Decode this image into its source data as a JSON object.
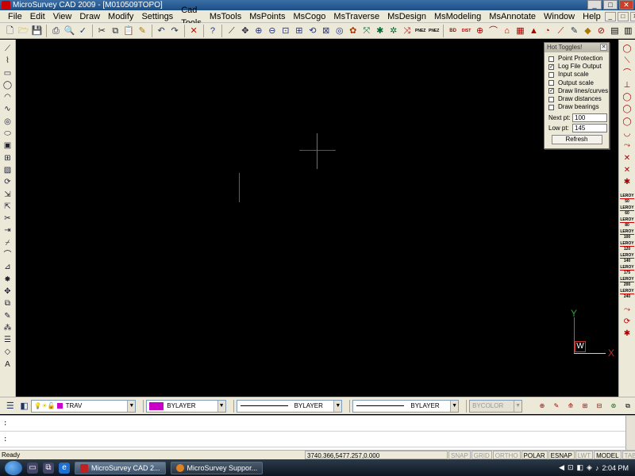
{
  "window": {
    "title": "MicroSurvey CAD 2009 - [M010509TOPO]",
    "buttons": [
      "_",
      "□",
      "✕"
    ]
  },
  "menubar": {
    "items": [
      "File",
      "Edit",
      "View",
      "Draw",
      "Modify",
      "Settings",
      "Cad Tools",
      "MsTools",
      "MsPoints",
      "MsCogo",
      "MsTraverse",
      "MsDesign",
      "MsModeling",
      "MsAnnotate",
      "Window",
      "Help"
    ],
    "mdi_buttons": [
      "_",
      "□",
      "✕"
    ]
  },
  "toolbar_top": {
    "icons": [
      "new-icon",
      "open-icon",
      "save-icon",
      "print-icon",
      "print-preview-icon",
      "spell-icon",
      "cut-icon",
      "copy-icon",
      "paste-icon",
      "match-properties-icon",
      "undo-icon",
      "redo-icon",
      "cancel-icon",
      "help-icon",
      "pan-line-icon",
      "zoom-realtime-icon",
      "zoom-in-icon",
      "zoom-out-icon",
      "zoom-window-icon",
      "zoom-extents-icon",
      "zoom-previous-icon",
      "zoom-all-icon",
      "zoom-pick-icon",
      "tools-1-icon",
      "tools-2-icon",
      "tools-3-icon",
      "tools-4-icon",
      "tools-5-icon",
      "pnez1-icon",
      "pnez2-icon",
      "bd-icon",
      "dist-icon",
      "tools-6-icon",
      "tools-7-icon",
      "tools-8-icon",
      "tools-9-icon",
      "tools-10-icon",
      "tools-11-icon",
      "tools-12-icon",
      "tools-13-icon",
      "tools-14-icon",
      "tools-15-icon",
      "tools-16-icon",
      "tools-17-icon"
    ],
    "text_buttons": {
      "pnez1": "PNEZ",
      "pnez2": "PNEZ",
      "bd": "BD",
      "dist": "DIST"
    }
  },
  "toolbar_left": {
    "icons": [
      "line-icon",
      "polyline-icon",
      "rectangle-icon",
      "circle-icon",
      "arc-icon",
      "spline-icon",
      "donut-icon",
      "ellipse-icon",
      "block-icon",
      "insert-icon",
      "hatch-icon",
      "rotate-icon",
      "stretch-icon",
      "scale-icon",
      "trim-icon",
      "extend-icon",
      "break-icon",
      "fillet-icon",
      "chamfer-icon",
      "explode-icon",
      "move-icon",
      "copy-obj-icon",
      "erase-icon",
      "array-icon",
      "properties-icon",
      "layer-icon",
      "text-icon"
    ]
  },
  "toolbar_right": {
    "icons": [
      "circle-r-icon",
      "line-r-icon",
      "arc-r-icon",
      "perpendicular-icon",
      "circle-r2-icon",
      "circle-r3-icon",
      "circle-r4-icon",
      "arc-r2-icon",
      "arrow-r-icon",
      "cross-r-icon",
      "cross-r2-icon",
      "cross-r3-icon"
    ],
    "leroy_labels": [
      "50",
      "60",
      "80",
      "100",
      "120",
      "140",
      "175",
      "200",
      "240"
    ],
    "leroy_word": "LEROY",
    "bottom_icons": [
      "edit-r-icon",
      "rotate-r-icon",
      "cross-r4-icon"
    ]
  },
  "hot_toggles": {
    "title": "Hot Toggles!",
    "close": "✕",
    "options": [
      {
        "label": "Point Protection",
        "checked": false
      },
      {
        "label": "Log File Output",
        "checked": true
      },
      {
        "label": "Input scale",
        "checked": false
      },
      {
        "label": "Output scale",
        "checked": false
      },
      {
        "label": "Draw lines/curves",
        "checked": true
      },
      {
        "label": "Draw distances",
        "checked": false
      },
      {
        "label": "Draw bearings",
        "checked": false
      }
    ],
    "next_pt_label": "Next pt:",
    "next_pt_value": "100",
    "low_pt_label": "Low pt:",
    "low_pt_value": "145",
    "refresh_label": "Refresh"
  },
  "ucs": {
    "y": "Y",
    "x": "X",
    "w": "W"
  },
  "props_bar": {
    "layer": "TRAV",
    "color": "BYLAYER",
    "color_hex": "#c800c8",
    "linetype": "BYLAYER",
    "lineweight": "BYLAYER",
    "plotstyle": "BYCOLOR"
  },
  "command": {
    "line1": ":",
    "line2": ":"
  },
  "status": {
    "ready": "Ready",
    "coords": "3740.366,5477.257,0.000",
    "modes": [
      {
        "label": "SNAP",
        "on": false
      },
      {
        "label": "GRID",
        "on": false
      },
      {
        "label": "ORTHO",
        "on": false
      },
      {
        "label": "POLAR",
        "on": true
      },
      {
        "label": "ESNAP",
        "on": true
      },
      {
        "label": "LWT",
        "on": false
      },
      {
        "label": "MODEL",
        "on": true
      },
      {
        "label": "TABLET",
        "on": false
      }
    ]
  },
  "taskbar": {
    "tasks": [
      {
        "label": "MicroSurvey CAD 2...",
        "active": true,
        "color": "#c02020"
      },
      {
        "label": "MicroSurvey Suppor...",
        "active": false,
        "color": "#e08020"
      }
    ],
    "time": "2:04 PM"
  }
}
